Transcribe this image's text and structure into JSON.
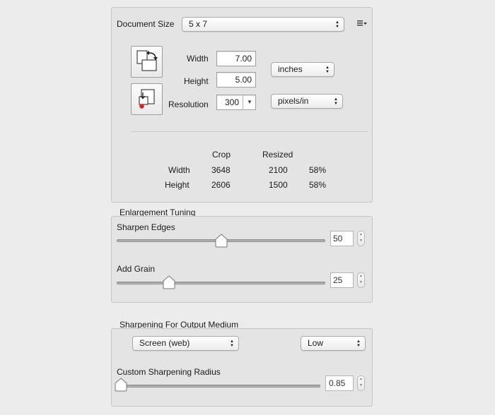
{
  "document_size": {
    "label": "Document Size",
    "preset": "5 x 7",
    "width_label": "Width",
    "width_value": "7.00",
    "height_label": "Height",
    "height_value": "5.00",
    "resolution_label": "Resolution",
    "resolution_value": "300",
    "unit": "inches",
    "resolution_unit": "pixels/in",
    "table": {
      "headers": [
        "Crop",
        "Resized"
      ],
      "rows": [
        {
          "label": "Width",
          "crop": "3648",
          "resized": "2100",
          "percent": "58%"
        },
        {
          "label": "Height",
          "crop": "2606",
          "resized": "1500",
          "percent": "58%"
        }
      ]
    }
  },
  "enlargement": {
    "title": "Enlargement Tuning",
    "sharpen_edges": {
      "label": "Sharpen Edges",
      "value": "50",
      "level": 0.5
    },
    "add_grain": {
      "label": "Add Grain",
      "value": "25",
      "level": 0.25
    }
  },
  "output": {
    "title": "Sharpening For Output Medium",
    "medium": "Screen (web)",
    "amount": "Low",
    "radius": {
      "label": "Custom Sharpening Radius",
      "value": "0.85",
      "level": 0.0
    }
  },
  "icons": {
    "menu": "list-menu-icon",
    "swap": "swap-orientation-icon",
    "reset": "reset-size-icon"
  }
}
